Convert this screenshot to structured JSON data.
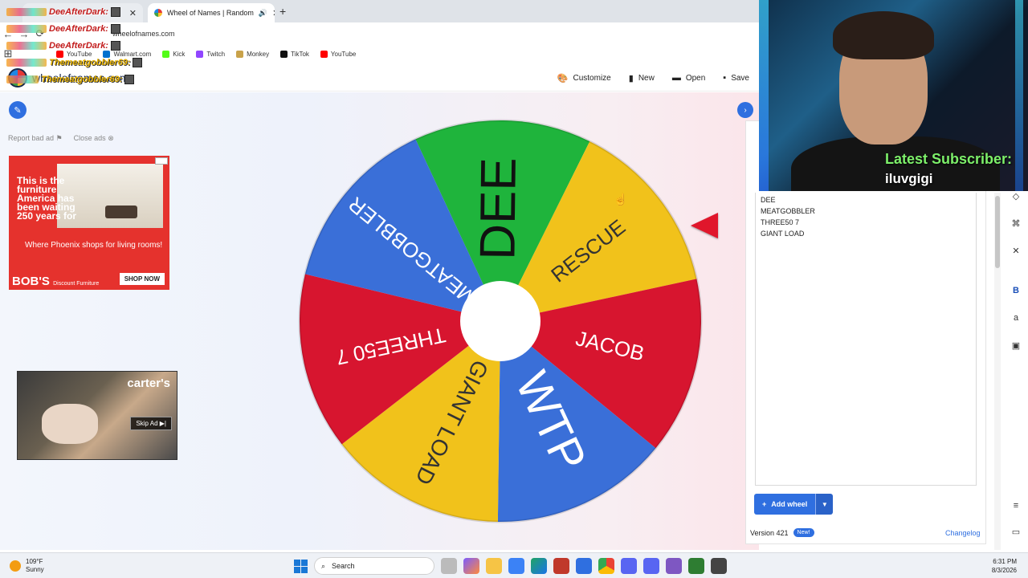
{
  "browser": {
    "active_tab_title": "Wheel of Names | Random",
    "close_glyph": "✕",
    "new_tab_glyph": "+",
    "url": "wheelofnames.com",
    "bookmarks": [
      "YouTube",
      "Walmart.com",
      "Kick",
      "Twitch",
      "Monkey",
      "TikTok",
      "YouTube"
    ]
  },
  "chat": {
    "lines": [
      "DeeAfterDark:",
      "DeeAfterDark:",
      "DeeAfterDark:",
      "Themeatgobbler69:",
      "Themeatgobbler69:"
    ]
  },
  "site": {
    "logo_text": "wheelofnames.com",
    "menu": {
      "customize": "Customize",
      "new": "New",
      "open": "Open",
      "save": "Save"
    },
    "report_ad": "Report bad ad",
    "close_ads": "Close ads"
  },
  "ads": {
    "furniture": {
      "headline": "This is the furniture America has been waiting 250 years for",
      "sub": "Where Phoenix shops for living rooms!",
      "brand": "BOB'S",
      "brand_sub": "Discount Furniture",
      "cta": "SHOP NOW"
    },
    "video": {
      "brand": "carter's",
      "skip": "Skip Ad ▶|"
    }
  },
  "wheel": {
    "segments": [
      {
        "label": "DEE",
        "color": "#1fb43c"
      },
      {
        "label": "RESCUE",
        "color": "#f1c21b"
      },
      {
        "label": "JACOB",
        "color": "#d7152f"
      },
      {
        "label": "WTP",
        "color": "#3a6fd8"
      },
      {
        "label": "GIANT LOAD",
        "color": "#f1c21b"
      },
      {
        "label": "THREE50 7",
        "color": "#d7152f"
      },
      {
        "label": "MEATGOBBLER",
        "color": "#3a6fd8"
      }
    ]
  },
  "entries": [
    "DEE",
    "MEATGOBBLER",
    "THREE50 7",
    "GIANT LOAD"
  ],
  "panel": {
    "add_wheel": "Add wheel",
    "version": "Version 421",
    "new_badge": "New!",
    "changelog": "Changelog"
  },
  "stream": {
    "subscriber_label": "Latest Subscriber:",
    "subscriber_name": "iluvgigi"
  },
  "taskbar": {
    "temp": "109°F",
    "condition": "Sunny",
    "search": "Search",
    "time": "6:31 PM",
    "date": "8/3/2026"
  },
  "colors": {
    "accent": "#2f6fe0",
    "pointer": "#e0162b"
  }
}
